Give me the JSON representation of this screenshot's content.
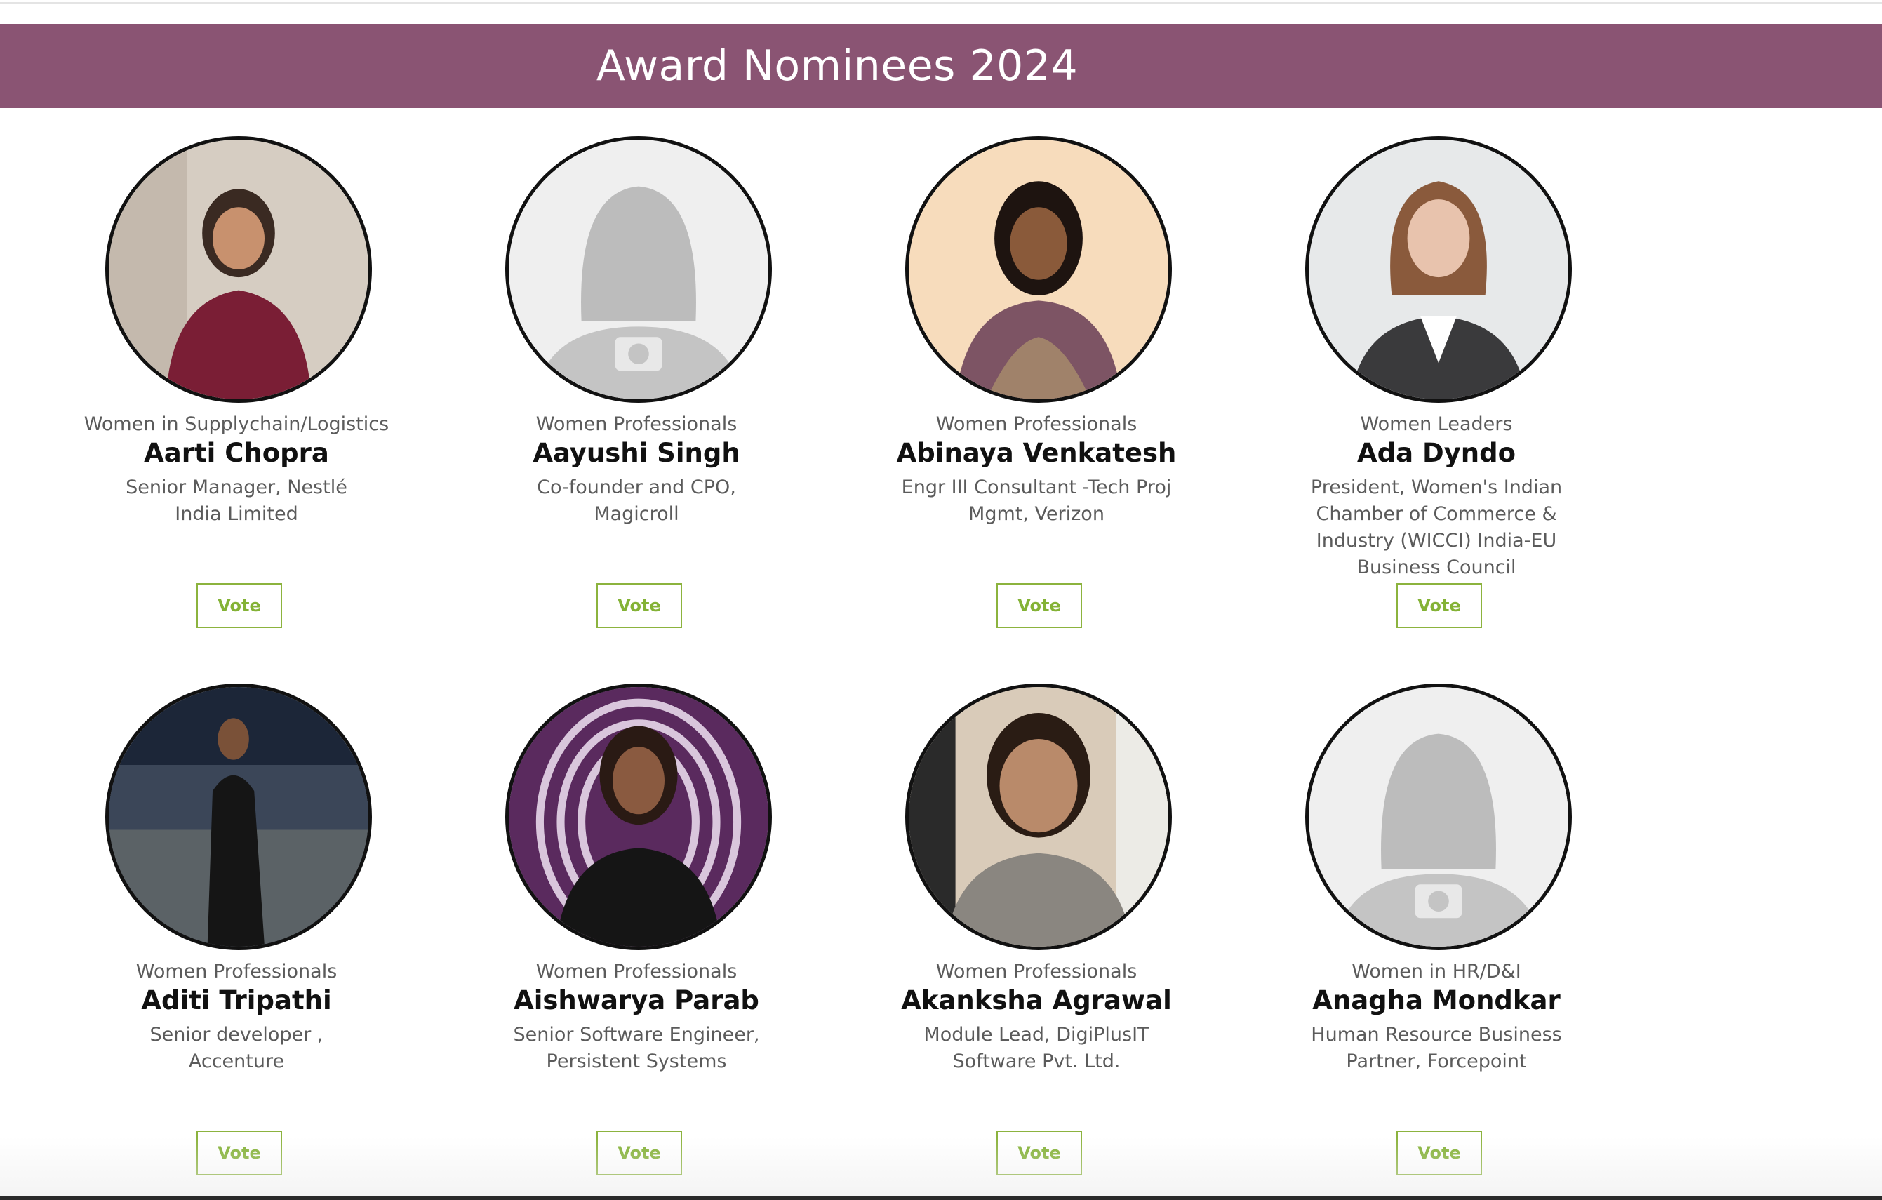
{
  "header": {
    "title": "Award Nominees 2024"
  },
  "colors": {
    "banner": "#8a5473",
    "vote_border": "#8cb33e",
    "vote_text": "#84b236"
  },
  "nominees": [
    {
      "category": "Women in Supplychain/Logistics",
      "name": "Aarti Chopra",
      "title": "Senior Manager, Nestlé India Limited",
      "vote_label": "Vote",
      "photo": "photo"
    },
    {
      "category": "Women Professionals",
      "name": "Aayushi Singh",
      "title": "Co-founder and CPO, Magicroll",
      "vote_label": "Vote",
      "photo": "placeholder"
    },
    {
      "category": "Women Professionals",
      "name": "Abinaya Venkatesh",
      "title": "Engr III Consultant -Tech Proj Mgmt, Verizon",
      "vote_label": "Vote",
      "photo": "photo"
    },
    {
      "category": "Women Leaders",
      "name": "Ada Dyndo",
      "title": "President, Women's Indian Chamber of Commerce & Industry (WICCI) India-EU Business Council",
      "vote_label": "Vote",
      "photo": "photo"
    },
    {
      "category": "Women Professionals",
      "name": "Aditi Tripathi",
      "title": "Senior developer , Accenture",
      "vote_label": "Vote",
      "photo": "photo"
    },
    {
      "category": "Women Professionals",
      "name": "Aishwarya Parab",
      "title": "Senior Software Engineer, Persistent Systems",
      "vote_label": "Vote",
      "photo": "photo"
    },
    {
      "category": "Women Professionals",
      "name": "Akanksha Agrawal",
      "title": "Module Lead, DigiPlusIT Software Pvt. Ltd.",
      "vote_label": "Vote",
      "photo": "photo"
    },
    {
      "category": "Women in HR/D&I",
      "name": "Anagha Mondkar",
      "title": "Human Resource Business Partner, Forcepoint",
      "vote_label": "Vote",
      "photo": "placeholder"
    }
  ]
}
